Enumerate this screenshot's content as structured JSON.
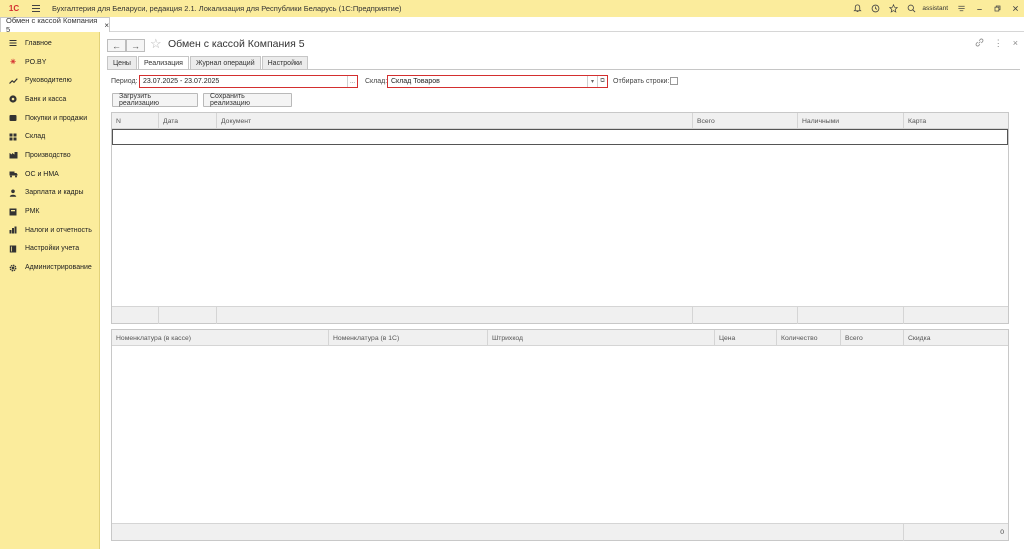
{
  "app": {
    "logo": "1С",
    "title": "Бухгалтерия для Беларуси, редакция 2.1. Локализация для Республики Беларусь   (1С:Предприятие)",
    "user": "assistant"
  },
  "open_tab": {
    "label": "Обмен с кассой Компания 5",
    "close": "×"
  },
  "sidebar": {
    "items": [
      {
        "label": "Главное",
        "icon": "menu-icon"
      },
      {
        "label": "PO.BY",
        "icon": "asterisk-icon"
      },
      {
        "label": "Руководителю",
        "icon": "trend-icon"
      },
      {
        "label": "Банк и касса",
        "icon": "coin-icon"
      },
      {
        "label": "Покупки и продажи",
        "icon": "cart-icon"
      },
      {
        "label": "Склад",
        "icon": "warehouse-icon"
      },
      {
        "label": "Производство",
        "icon": "factory-icon"
      },
      {
        "label": "ОС и НМА",
        "icon": "truck-icon"
      },
      {
        "label": "Зарплата и кадры",
        "icon": "person-icon"
      },
      {
        "label": "РМК",
        "icon": "register-icon"
      },
      {
        "label": "Налоги и отчетность",
        "icon": "report-icon"
      },
      {
        "label": "Настройки учета",
        "icon": "book-icon"
      },
      {
        "label": "Администрирование",
        "icon": "gear-icon"
      }
    ]
  },
  "form": {
    "title": "Обмен с кассой Компания 5",
    "tabs": [
      {
        "label": "Цены"
      },
      {
        "label": "Реализация"
      },
      {
        "label": "Журнал операций"
      },
      {
        "label": "Настройки"
      }
    ],
    "period_label": "Период:",
    "period_value": "23.07.2025 - 23.07.2025",
    "period_btn": "...",
    "warehouse_label": "Склад:",
    "warehouse_value": "Склад Товаров",
    "select_rows_label": "Отбирать строки:",
    "load_button": "Загрузить реализацию",
    "save_button": "Сохранить реализацию"
  },
  "table_top": {
    "columns": [
      "N",
      "Дата",
      "Документ",
      "Всего",
      "Наличными",
      "Карта"
    ]
  },
  "table_bottom": {
    "columns": [
      "Номенклатура (в кассе)",
      "Номенклатура (в 1С)",
      "Штрихкод",
      "Цена",
      "Количество",
      "Всего",
      "Скидка"
    ],
    "footer_total": "0"
  },
  "colors": {
    "yellow": "#fbec9c",
    "accent_red": "#d32f2f"
  }
}
